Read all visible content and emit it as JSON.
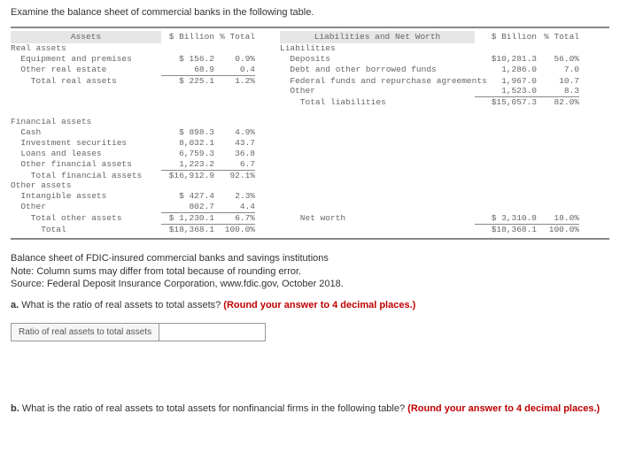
{
  "intro": "Examine the balance sheet of commercial banks in the following table.",
  "headers": {
    "assets": "Assets",
    "billion": "$ Billion",
    "pctTotal": "% Total",
    "lnw": "Liabilities and Net Worth"
  },
  "assets": {
    "sections": [
      {
        "title": "Real assets",
        "rows": [
          {
            "name": "  Equipment and premises",
            "bill": "$   156.2",
            "pct": "0.9%"
          },
          {
            "name": "  Other real estate",
            "bill": "68.9",
            "pct": "0.4",
            "ul": true
          }
        ],
        "total": {
          "name": "    Total real assets",
          "bill": "$   225.1",
          "pct": "1.2%"
        }
      },
      {
        "title": "Financial assets",
        "rows": [
          {
            "name": "  Cash",
            "bill": "$   898.3",
            "pct": "4.9%"
          },
          {
            "name": "  Investment securities",
            "bill": "8,032.1",
            "pct": "43.7"
          },
          {
            "name": "  Loans and leases",
            "bill": "6,759.3",
            "pct": "36.8"
          },
          {
            "name": "  Other financial assets",
            "bill": "1,223.2",
            "pct": "6.7",
            "ul": true
          }
        ],
        "total": {
          "name": "    Total financial assets",
          "bill": "$16,912.9",
          "pct": "92.1%"
        }
      },
      {
        "title": "Other assets",
        "rows": [
          {
            "name": "  Intangible assets",
            "bill": "$   427.4",
            "pct": "2.3%"
          },
          {
            "name": "  Other",
            "bill": "802.7",
            "pct": "4.4",
            "ul": true
          }
        ],
        "total": {
          "name": "    Total other assets",
          "bill": "$ 1,230.1",
          "pct": "6.7%"
        }
      }
    ],
    "grand": {
      "name": "      Total",
      "bill": "$18,368.1",
      "pct": "100.0%"
    }
  },
  "liabilities": {
    "title": "Liabilities",
    "rows": [
      {
        "name": "  Deposits",
        "bill": "$10,281.3",
        "pct": "56.0%"
      },
      {
        "name": "  Debt and other borrowed funds",
        "bill": "1,286.0",
        "pct": "7.0"
      },
      {
        "name": "  Federal funds and repurchase agreements",
        "bill": "1,967.0",
        "pct": "10.7"
      },
      {
        "name": "  Other",
        "bill": "1,523.0",
        "pct": "8.3",
        "ul": true
      }
    ],
    "total": {
      "name": "    Total liabilities",
      "bill": "$15,057.3",
      "pct": "82.0%"
    }
  },
  "networth": {
    "name": "    Net worth",
    "bill": "$ 3,310.8",
    "pct": "18.0%"
  },
  "grandL": {
    "bill": "$18,368.1",
    "pct": "100.0%"
  },
  "notes": {
    "l1": "Balance sheet of FDIC-insured commercial banks and savings institutions",
    "l2": "Note: Column sums may differ from total because of rounding error.",
    "l3": "Source: Federal Deposit Insurance Corporation, www.fdic.gov, October 2018."
  },
  "qA": {
    "label": "a.",
    "text": " What is the ratio of real assets to total assets? ",
    "hint": "(Round your answer to 4 decimal places.)"
  },
  "inputLabel": "Ratio of real assets to total assets",
  "qB": {
    "label": "b.",
    "text": " What is the ratio of real assets to total assets for nonfinancial firms in the following table? ",
    "hint": "(Round your answer to 4 decimal places.)"
  }
}
